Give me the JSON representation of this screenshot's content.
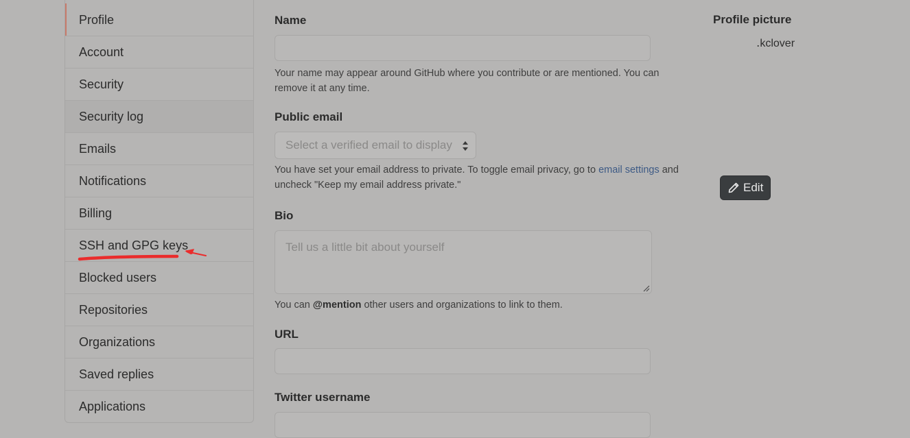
{
  "sidebar": {
    "items": [
      {
        "label": "Profile"
      },
      {
        "label": "Account"
      },
      {
        "label": "Security"
      },
      {
        "label": "Security log"
      },
      {
        "label": "Emails"
      },
      {
        "label": "Notifications"
      },
      {
        "label": "Billing"
      },
      {
        "label": "SSH and GPG keys"
      },
      {
        "label": "Blocked users"
      },
      {
        "label": "Repositories"
      },
      {
        "label": "Organizations"
      },
      {
        "label": "Saved replies"
      },
      {
        "label": "Applications"
      }
    ],
    "active_item": "Profile",
    "annotated_item": "SSH and GPG keys"
  },
  "form": {
    "name": {
      "label": "Name",
      "value": "",
      "note": "Your name may appear around GitHub where you contribute or are mentioned. You can remove it at any time."
    },
    "public_email": {
      "label": "Public email",
      "selected": "Select a verified email to display",
      "note_before": "You have set your email address to private. To toggle email privacy, go to ",
      "note_link": "email settings",
      "note_after": " and uncheck \"Keep my email address private.\""
    },
    "bio": {
      "label": "Bio",
      "placeholder": "Tell us a little bit about yourself",
      "note_before": "You can ",
      "note_strong": "@mention",
      "note_after": " other users and organizations to link to them."
    },
    "url": {
      "label": "URL",
      "value": ""
    },
    "twitter": {
      "label": "Twitter username",
      "value": ""
    }
  },
  "profile_picture": {
    "title": "Profile picture",
    "alt_text": "․kclover",
    "edit_label": "Edit"
  },
  "colors": {
    "annotation": "#ea2c2c",
    "link": "#3d5a85",
    "edit_button_bg": "#3a3d3f"
  }
}
